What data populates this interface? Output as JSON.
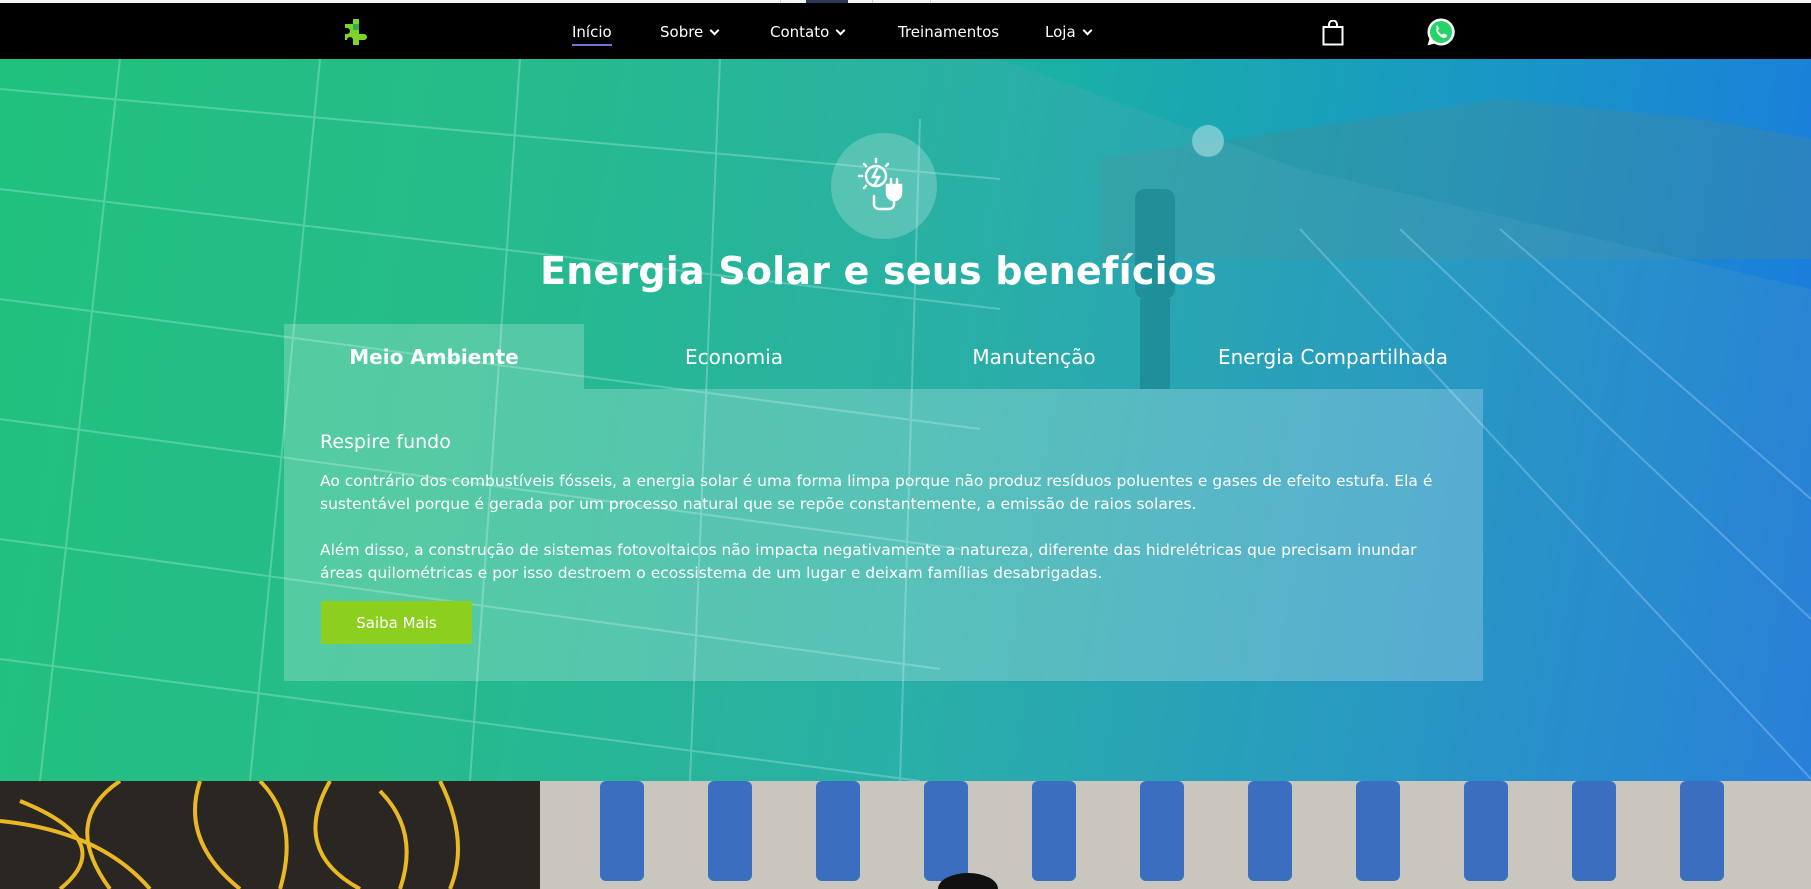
{
  "nav": {
    "items": [
      {
        "label": "Início",
        "active": true,
        "dropdown": false
      },
      {
        "label": "Sobre",
        "active": false,
        "dropdown": true
      },
      {
        "label": "Contato",
        "active": false,
        "dropdown": true
      },
      {
        "label": "Treinamentos",
        "active": false,
        "dropdown": false
      },
      {
        "label": "Loja",
        "active": false,
        "dropdown": true
      }
    ]
  },
  "icons": {
    "logo": "puzzle-piece-logo-icon",
    "cart": "shopping-bag-icon",
    "whatsapp": "whatsapp-icon",
    "hero": "solar-plug-icon",
    "chevron": "chevron-down-icon"
  },
  "hero": {
    "title": "Energia Solar e seus benefícios",
    "tabs": [
      "Meio Ambiente",
      "Economia",
      "Manutenção",
      "Energia Compartilhada"
    ],
    "active_tab": 0,
    "panel": {
      "heading": "Respire fundo",
      "paragraph1": "Ao contrário dos combustíveis fósseis, a energia solar é uma forma limpa porque não produz resíduos poluentes e gases de efeito estufa. Ela é sustentável porque é gerada por um processo natural que se repõe constantemente, a emissão de raios solares.",
      "paragraph2": "Além disso, a construção de sistemas fotovoltaicos não impacta negativamente a natureza, diferente das hidrelétricas que precisam inundar áreas quilométricas e por isso destroem o ecossistema de um lugar e deixam famílias desabrigadas.",
      "button_label": "Saiba Mais"
    }
  },
  "colors": {
    "header_bg": "#000000",
    "gradient_start": "#0fc870",
    "gradient_end": "#1a78e0",
    "button": "#8ccf1e",
    "active_underline": "#6b73d8"
  }
}
